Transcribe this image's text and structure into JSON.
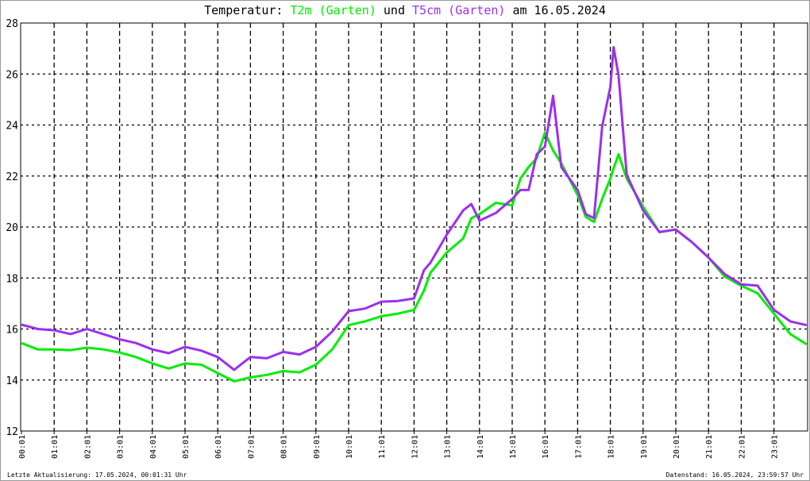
{
  "chart_data": {
    "type": "line",
    "title_parts": {
      "prefix": "Temperatur:",
      "series1": "T2m (Garten)",
      "joiner": "und",
      "series2": "T5cm (Garten)",
      "suffix": "am 16.05.2024"
    },
    "ylim": [
      12,
      28
    ],
    "yticks": [
      12,
      14,
      16,
      18,
      20,
      22,
      24,
      26,
      28
    ],
    "xlim": [
      0,
      24
    ],
    "xtick_labels": [
      "00:01",
      "01:01",
      "02:01",
      "03:01",
      "04:01",
      "05:01",
      "06:01",
      "07:01",
      "08:01",
      "09:01",
      "10:01",
      "11:01",
      "12:01",
      "13:01",
      "14:01",
      "15:01",
      "16:01",
      "17:01",
      "18:01",
      "19:01",
      "20:01",
      "21:01",
      "22:01",
      "23:01"
    ],
    "grid": true,
    "x": [
      0,
      0.5,
      1,
      1.5,
      2,
      2.5,
      3,
      3.5,
      4,
      4.5,
      5,
      5.5,
      6,
      6.5,
      7,
      7.5,
      8,
      8.5,
      9,
      9.5,
      10,
      10.5,
      11,
      11.5,
      12,
      12.3,
      12.5,
      13,
      13.5,
      13.75,
      14,
      14.5,
      15,
      15.25,
      15.5,
      15.75,
      16,
      16.25,
      16.5,
      17,
      17.25,
      17.5,
      17.75,
      18,
      18.1,
      18.25,
      18.5,
      19,
      19.5,
      20,
      20.5,
      21,
      21.5,
      22,
      22.5,
      23,
      23.5,
      24
    ],
    "series": [
      {
        "name": "T2m (Garten)",
        "color": "#00ee00",
        "values": [
          15.45,
          15.2,
          15.2,
          15.17,
          15.27,
          15.2,
          15.08,
          14.9,
          14.65,
          14.45,
          14.65,
          14.6,
          14.27,
          13.95,
          14.1,
          14.2,
          14.35,
          14.3,
          14.6,
          15.2,
          16.15,
          16.3,
          16.5,
          16.6,
          16.75,
          17.5,
          18.2,
          19.0,
          19.55,
          20.35,
          20.5,
          20.95,
          20.85,
          21.9,
          22.35,
          22.7,
          23.7,
          23.0,
          22.5,
          21.25,
          20.4,
          20.2,
          21.1,
          21.9,
          22.3,
          22.85,
          21.9,
          20.8,
          19.8,
          19.9,
          19.4,
          18.8,
          18.05,
          17.7,
          17.4,
          16.6,
          15.8,
          15.4
        ]
      },
      {
        "name": "T5cm (Garten)",
        "color": "#9b30ee",
        "values": [
          16.17,
          16.0,
          15.95,
          15.8,
          16.0,
          15.8,
          15.6,
          15.45,
          15.2,
          15.05,
          15.3,
          15.15,
          14.9,
          14.4,
          14.9,
          14.85,
          15.1,
          15.0,
          15.3,
          15.9,
          16.7,
          16.8,
          17.07,
          17.1,
          17.2,
          18.3,
          18.6,
          19.7,
          20.65,
          20.9,
          20.25,
          20.55,
          21.1,
          21.45,
          21.45,
          22.85,
          23.15,
          25.15,
          22.35,
          21.45,
          20.5,
          20.35,
          23.95,
          25.5,
          27.05,
          25.95,
          22.05,
          20.65,
          19.8,
          19.9,
          19.4,
          18.8,
          18.15,
          17.75,
          17.7,
          16.75,
          16.3,
          16.15
        ]
      }
    ]
  },
  "footer": {
    "left": "Letzte Aktualisierung: 17.05.2024, 00:01:31 Uhr",
    "right": "Datenstand: 16.05.2024, 23:59:57 Uhr"
  }
}
